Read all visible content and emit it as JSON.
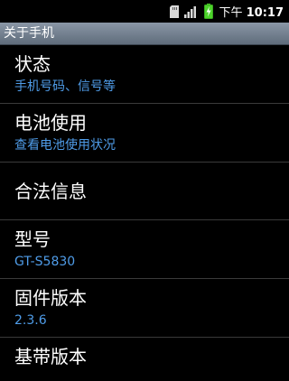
{
  "status_bar": {
    "icons": [
      "sd-card-icon",
      "signal-icon",
      "battery-charging-icon"
    ],
    "ampm": "下午",
    "time": "10:17"
  },
  "title_bar": {
    "title": "关于手机"
  },
  "items": [
    {
      "title": "状态",
      "summary": "手机号码、信号等"
    },
    {
      "title": "电池使用",
      "summary": "查看电池使用状况"
    },
    {
      "title": "合法信息"
    },
    {
      "title": "型号",
      "summary": "GT-S5830"
    },
    {
      "title": "固件版本",
      "summary": "2.3.6"
    },
    {
      "title": "基带版本"
    }
  ],
  "colors": {
    "background": "#000000",
    "summary_text": "#4f9ce8",
    "title_bar": "#7a8796",
    "battery": "#4cd32a"
  }
}
